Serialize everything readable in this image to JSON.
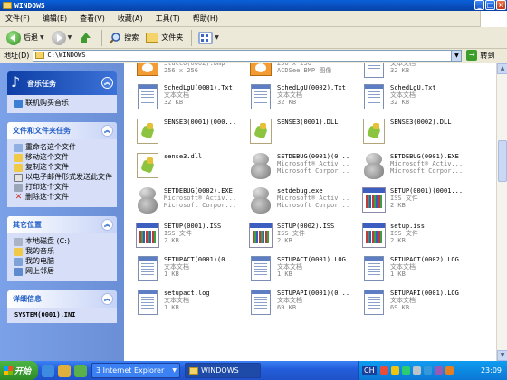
{
  "window": {
    "title": "WINDOWS"
  },
  "menu": [
    "文件(F)",
    "编辑(E)",
    "查看(V)",
    "收藏(A)",
    "工具(T)",
    "帮助(H)"
  ],
  "toolbar": {
    "back_label": "后退",
    "search_label": "搜索",
    "folders_label": "文件夹"
  },
  "address": {
    "label": "地址(D)",
    "value": "C:\\WINDOWS",
    "go_label": "转到"
  },
  "left": {
    "music": {
      "title": "音乐任务",
      "items": [
        "联机购买音乐"
      ]
    },
    "tasks": {
      "title": "文件和文件夹任务",
      "items": [
        "重命名这个文件",
        "移动这个文件",
        "复制这个文件",
        "以电子邮件形式发送此文件",
        "打印这个文件",
        "删除这个文件"
      ]
    },
    "places": {
      "title": "其它位置",
      "items": [
        "本地磁盘 (C:)",
        "我的音乐",
        "我的电脑",
        "网上邻居"
      ]
    },
    "details": {
      "title": "详细信息",
      "file": "SYSTEM(0001).INI"
    }
  },
  "files": [
    {
      "icon": "bmp-icon",
      "l1": "Santa Fe",
      "l2": "Stucco(0002).bmp",
      "l3": "256 x 256"
    },
    {
      "icon": "bmp-icon",
      "l1": "Santa Fe Stucco.bmp",
      "l2": "256 x 256",
      "l3": "ACDSee BMP 图像"
    },
    {
      "icon": "text-icon",
      "l1": "SchedLgU(0001)(0...",
      "l2": "文本文档",
      "l3": "32 KB"
    },
    {
      "icon": "text-icon",
      "l1": "SchedLgU(0001).Txt",
      "l2": "文本文档",
      "l3": "32 KB"
    },
    {
      "icon": "text-icon",
      "l1": "SchedLgU(0002).Txt",
      "l2": "文本文档",
      "l3": "32 KB"
    },
    {
      "icon": "text-icon",
      "l1": "SchedLgU.Txt",
      "l2": "文本文档",
      "l3": "32 KB"
    },
    {
      "icon": "dll-icon",
      "l1": "SENSE3(0001)(000...",
      "l2": "",
      "l3": ""
    },
    {
      "icon": "dll-icon",
      "l1": "SENSE3(0001).DLL",
      "l2": "",
      "l3": ""
    },
    {
      "icon": "dll-icon",
      "l1": "SENSE3(0002).DLL",
      "l2": "",
      "l3": ""
    },
    {
      "icon": "dll-icon",
      "l1": "sense3.dll",
      "l2": "",
      "l3": ""
    },
    {
      "icon": "bear-icon",
      "l1": "SETDEBUG(0001)(0...",
      "l2": "Microsoft® Activ...",
      "l3": "Microsoft Corpor..."
    },
    {
      "icon": "bear-icon",
      "l1": "SETDEBUG(0001).EXE",
      "l2": "Microsoft® Activ...",
      "l3": "Microsoft Corpor..."
    },
    {
      "icon": "bear-icon",
      "l1": "SETDEBUG(0002).EXE",
      "l2": "Microsoft® Activ...",
      "l3": "Microsoft Corpor..."
    },
    {
      "icon": "bear-icon",
      "l1": "setdebug.exe",
      "l2": "Microsoft® Activ...",
      "l3": "Microsoft Corpor..."
    },
    {
      "icon": "iss-icon",
      "l1": "SETUP(0001)(0001...",
      "l2": "ISS 文件",
      "l3": "2 KB"
    },
    {
      "icon": "iss-icon",
      "l1": "SETUP(0001).ISS",
      "l2": "ISS 文件",
      "l3": "2 KB"
    },
    {
      "icon": "iss-icon",
      "l1": "SETUP(0002).ISS",
      "l2": "ISS 文件",
      "l3": "2 KB"
    },
    {
      "icon": "iss-icon",
      "l1": "setup.iss",
      "l2": "ISS 文件",
      "l3": "2 KB"
    },
    {
      "icon": "text-icon",
      "l1": "SETUPACT(0001)(0...",
      "l2": "文本文档",
      "l3": "1 KB"
    },
    {
      "icon": "text-icon",
      "l1": "SETUPACT(0001).LOG",
      "l2": "文本文档",
      "l3": "1 KB"
    },
    {
      "icon": "text-icon",
      "l1": "SETUPACT(0002).LOG",
      "l2": "文本文档",
      "l3": "1 KB"
    },
    {
      "icon": "text-icon",
      "l1": "setupact.log",
      "l2": "文本文档",
      "l3": "1 KB"
    },
    {
      "icon": "text-icon",
      "l1": "SETUPAPI(0001)(0...",
      "l2": "文本文档",
      "l3": "69 KB"
    },
    {
      "icon": "text-icon",
      "l1": "SETUPAPI(0001).LOG",
      "l2": "文本文档",
      "l3": "69 KB"
    }
  ],
  "taskbar": {
    "start_label": "开始",
    "tasks": [
      "3 Internet Explorer",
      "WINDOWS"
    ],
    "ime": "CH",
    "clock": "23:09"
  }
}
